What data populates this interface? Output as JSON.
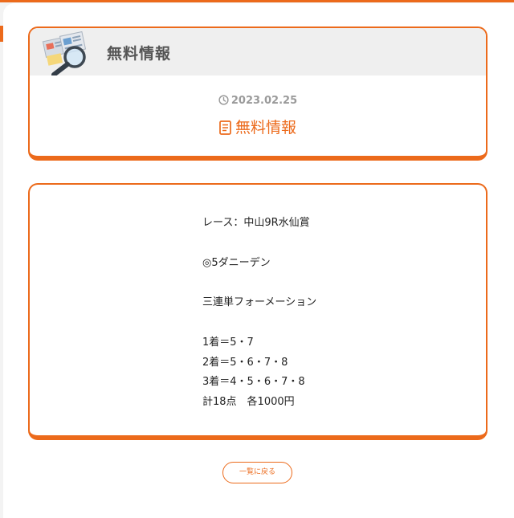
{
  "header": {
    "title": "無料情報"
  },
  "post": {
    "date": "2023.02.25",
    "title": "無料情報"
  },
  "content": {
    "race": "レース：中山9R水仙賞",
    "pick": "◎5ダニーデン",
    "bet_type": "三連単フォーメーション",
    "first": "1着＝5・7",
    "second": "2着＝5・6・7・8",
    "third": "3着＝4・5・6・7・8",
    "total": "計18点　各1000円"
  },
  "nav": {
    "back_label": "一覧に戻る"
  },
  "colors": {
    "accent": "#ec6a1b",
    "header_band": "#efefef",
    "heading_text": "#555555",
    "date_text": "#9a9a9a"
  },
  "icons": {
    "header_illustration": "magnifier-document-icon",
    "date": "clock-icon",
    "title": "document-icon"
  }
}
